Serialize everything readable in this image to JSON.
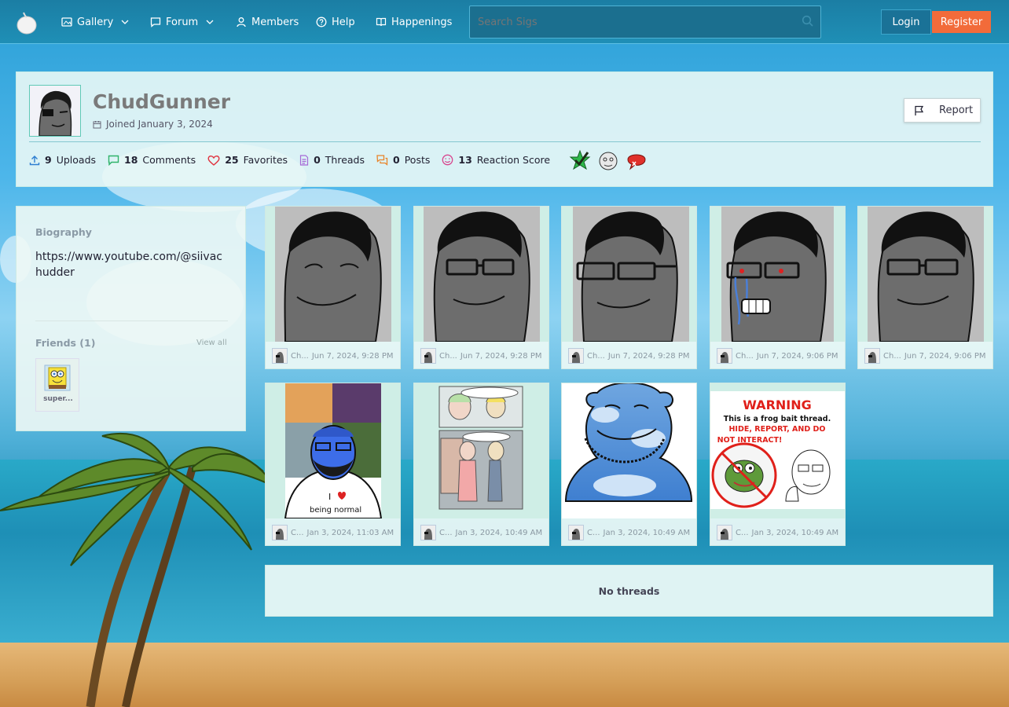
{
  "nav": {
    "items": [
      {
        "label": "Gallery",
        "icon": "image-icon",
        "dropdown": true
      },
      {
        "label": "Forum",
        "icon": "chat-icon",
        "dropdown": true
      },
      {
        "label": "Members",
        "icon": "user-icon",
        "dropdown": false
      },
      {
        "label": "Help",
        "icon": "help-icon",
        "dropdown": false
      },
      {
        "label": "Happenings",
        "icon": "book-icon",
        "dropdown": false
      }
    ],
    "search_placeholder": "Search Sigs",
    "login_label": "Login",
    "register_label": "Register"
  },
  "profile": {
    "username": "ChudGunner",
    "joined": "Joined January 3, 2024",
    "report_label": "Report",
    "stats": [
      {
        "count": "9",
        "label": "Uploads"
      },
      {
        "count": "18",
        "label": "Comments"
      },
      {
        "count": "25",
        "label": "Favorites"
      },
      {
        "count": "0",
        "label": "Threads"
      },
      {
        "count": "0",
        "label": "Posts"
      },
      {
        "count": "13",
        "label": "Reaction Score"
      }
    ]
  },
  "sidebar": {
    "biography_heading": "Biography",
    "biography_text": "https://www.youtube.com/@siivachudder",
    "friends_heading": "Friends (1)",
    "view_all_label": "View all",
    "friend_name": "super..."
  },
  "gallery": [
    {
      "author": "Ch...",
      "date": "Jun 7, 2024, 9:28 PM"
    },
    {
      "author": "Ch...",
      "date": "Jun 7, 2024, 9:28 PM"
    },
    {
      "author": "Ch...",
      "date": "Jun 7, 2024, 9:28 PM"
    },
    {
      "author": "Ch...",
      "date": "Jun 7, 2024, 9:06 PM"
    },
    {
      "author": "Ch...",
      "date": "Jun 7, 2024, 9:06 PM"
    },
    {
      "author": "C...",
      "date": "Jan 3, 2024, 11:03 AM",
      "caption_line1": "I",
      "caption_line2": "being normal"
    },
    {
      "author": "C...",
      "date": "Jan 3, 2024, 10:49 AM"
    },
    {
      "author": "C...",
      "date": "Jan 3, 2024, 10:49 AM"
    },
    {
      "author": "C...",
      "date": "Jan 3, 2024, 10:49 AM",
      "warning_title": "WARNING",
      "warning_line1": "This is a frog bait thread.",
      "warning_line2": "HIDE, REPORT, AND DO",
      "warning_line3": "NOT INTERACT!"
    }
  ],
  "threads": {
    "empty_label": "No threads"
  },
  "colors": {
    "accent": "#f26b3a",
    "header": "#1f8fb6"
  }
}
